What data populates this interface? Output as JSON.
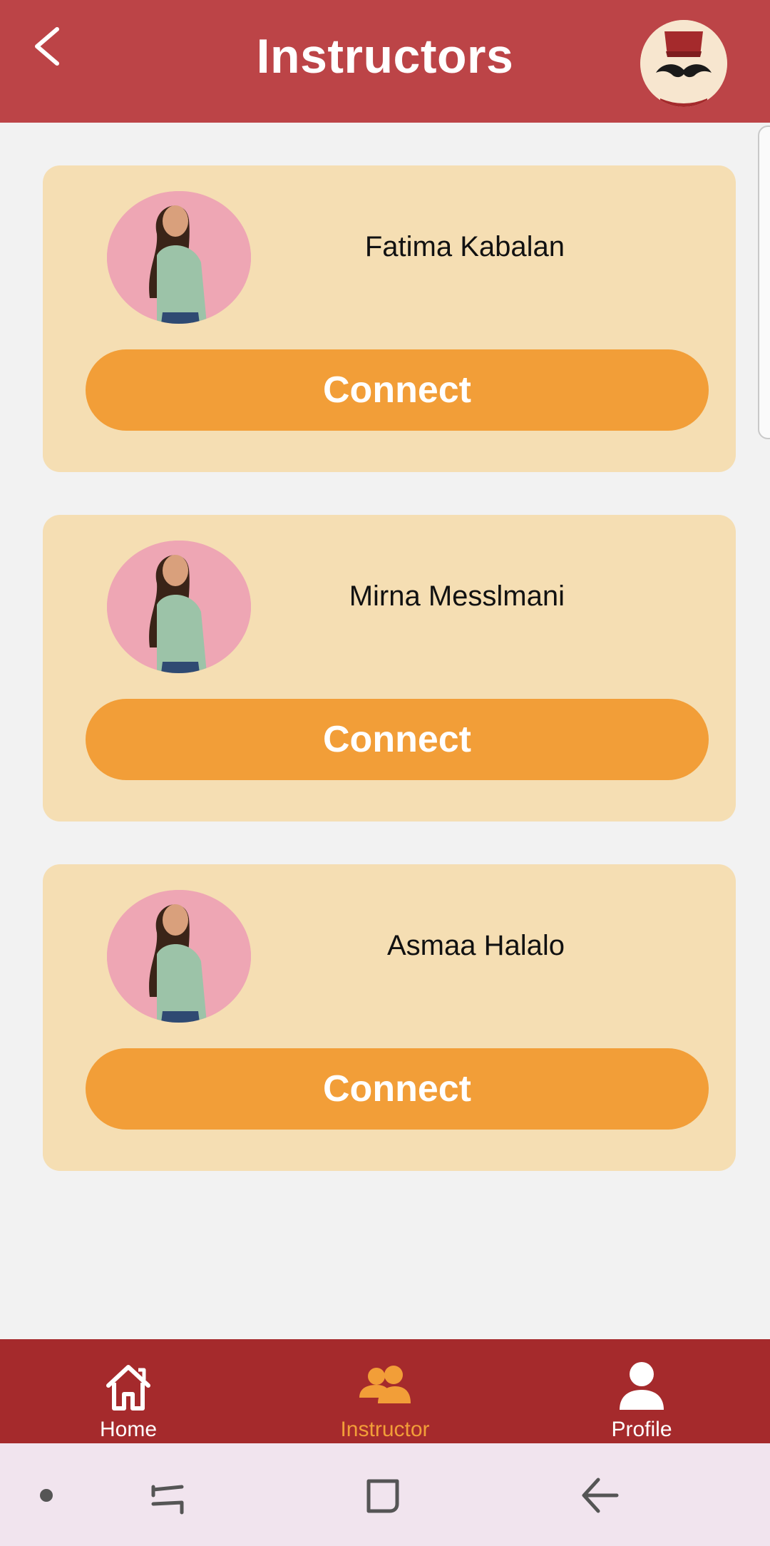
{
  "header": {
    "title": "Instructors",
    "back_icon": "chevron-left-icon",
    "mascot_icon": "fez-mustache-mascot-icon"
  },
  "instructors": [
    {
      "name": "Fatima Kabalan",
      "button_label": "Connect",
      "avatar": "instructor-photo"
    },
    {
      "name": "Mirna Messlmani",
      "button_label": "Connect",
      "avatar": "instructor-photo"
    },
    {
      "name": "Asmaa Halalo",
      "button_label": "Connect",
      "avatar": "instructor-photo"
    }
  ],
  "bottom_nav": {
    "items": [
      {
        "label": "Home",
        "icon": "home-icon",
        "active": false
      },
      {
        "label": "Instructor",
        "icon": "group-icon",
        "active": true
      },
      {
        "label": "Profile",
        "icon": "person-icon",
        "active": false
      }
    ]
  },
  "system_nav": {
    "items": [
      "dot-icon",
      "recent-apps-icon",
      "home-square-icon",
      "back-arrow-icon"
    ]
  },
  "colors": {
    "header_bg": "#bc4447",
    "card_bg": "#f5deb3",
    "button_bg": "#f29e38",
    "nav_bg": "#a52a2c",
    "nav_active": "#f29e38",
    "page_bg": "#f2f2f2"
  }
}
